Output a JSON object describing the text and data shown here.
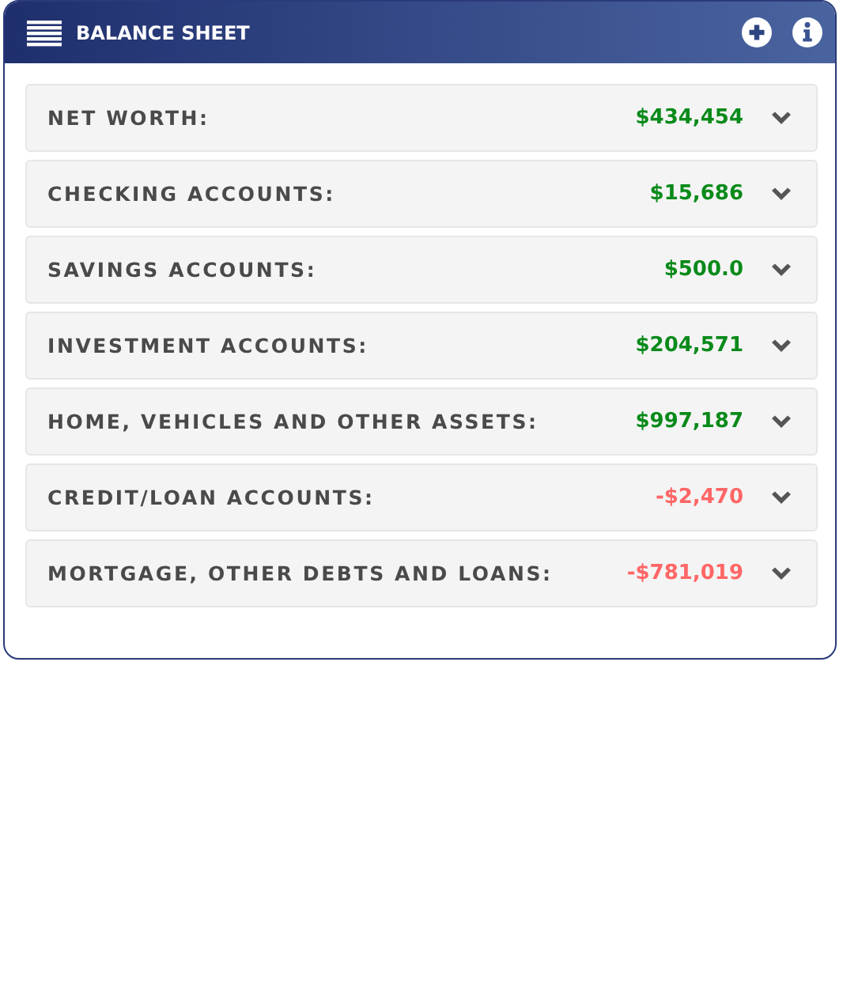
{
  "header": {
    "title": "BALANCE SHEET"
  },
  "rows": [
    {
      "label": "NET WORTH:",
      "value": "$434,454",
      "color": "#0a8a1a",
      "expanded": false
    },
    {
      "label": "CHECKING ACCOUNTS:",
      "value": "$15,686",
      "color": "#0a8a1a",
      "expanded": false
    },
    {
      "label": "SAVINGS ACCOUNTS:",
      "value": "$500.0",
      "color": "#0a8a1a",
      "expanded": false
    },
    {
      "label": "INVESTMENT ACCOUNTS:",
      "value": "$204,571",
      "color": "#0a8a1a",
      "expanded": false
    },
    {
      "label": "HOME, VEHICLES AND OTHER ASSETS:",
      "value": "$997,187",
      "color": "#0a8a1a",
      "expanded": false
    },
    {
      "label": "CREDIT/LOAN ACCOUNTS:",
      "value": "-$2,470",
      "color": "#ff6666",
      "expanded": false
    },
    {
      "label": "MORTGAGE, OTHER DEBTS AND LOANS:",
      "value": "-$781,019",
      "color": "#ff6666",
      "expanded": false
    }
  ]
}
